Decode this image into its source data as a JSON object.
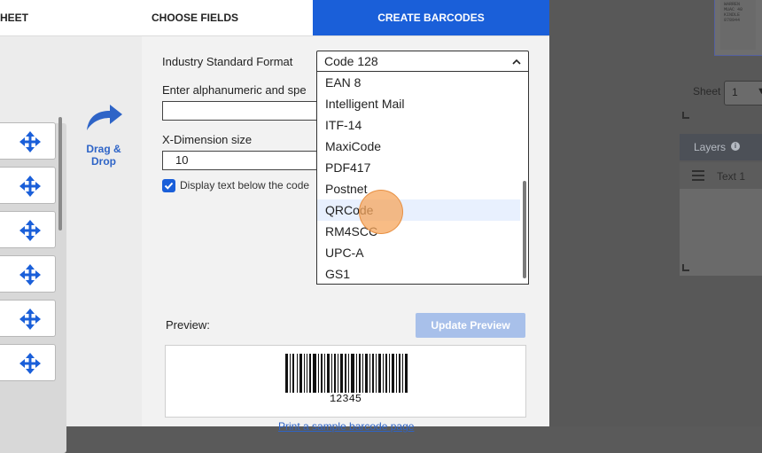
{
  "tabs": {
    "sheet": "HEET",
    "choose_fields": "CHOOSE FIELDS",
    "create_barcodes": "CREATE BARCODES"
  },
  "left": {
    "drag_drop": "Drag & Drop"
  },
  "form": {
    "format_label": "Industry Standard Format",
    "format_value": "Code 128",
    "alnum_label": "Enter alphanumeric and spe",
    "alnum_value": "",
    "xdim_label": "X-Dimension size",
    "xdim_value": "10",
    "display_text_label": "Display text below the code",
    "display_text_checked": true
  },
  "dropdown": {
    "options": [
      "EAN 8",
      "Intelligent Mail",
      "ITF-14",
      "MaxiCode",
      "PDF417",
      "Postnet",
      "QRCode",
      "RM4SCC",
      "UPC-A",
      "GS1"
    ],
    "highlighted": "QRCode"
  },
  "preview": {
    "label": "Preview:",
    "update_button": "Update Preview",
    "barcode_text": "12345",
    "sample_link": "Print a sample barcode page"
  },
  "background": {
    "sheet_label": "Sheet",
    "sheet_value": "1",
    "layers_title": "Layers",
    "layer_item": "Text 1",
    "thumb_text": "WARREN\nMUAC 40\nKINDLE\n878944"
  },
  "colors": {
    "accent": "#1a5fd9",
    "link": "#2e64c7",
    "highlight": "#e8f0fe",
    "cursor": "#f5a65c"
  },
  "icons": {
    "move": "four-way-arrow-icon",
    "drag": "curved-arrow-icon",
    "chevron": "chevron-up-icon",
    "check": "checkmark-icon"
  }
}
